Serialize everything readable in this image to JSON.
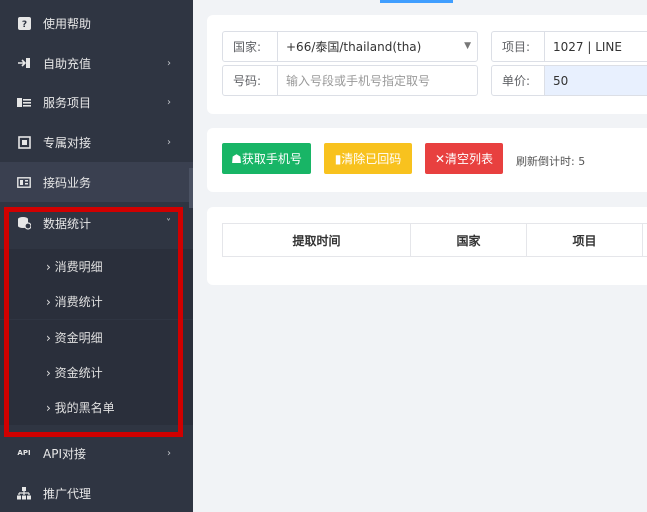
{
  "sidebar": {
    "items": [
      {
        "label": "使用帮助",
        "icon": "help-icon",
        "chevron": ""
      },
      {
        "label": "自助充值",
        "icon": "recharge-icon",
        "chevron": "›"
      },
      {
        "label": "服务项目",
        "icon": "service-icon",
        "chevron": "›"
      },
      {
        "label": "专属对接",
        "icon": "dedicated-icon",
        "chevron": "›"
      },
      {
        "label": "接码业务",
        "icon": "sms-code-icon",
        "chevron": "›"
      },
      {
        "label": "数据统计",
        "icon": "database-icon",
        "chevron": "˅"
      },
      {
        "label": "API对接",
        "icon": "api-icon",
        "chevron": "›"
      },
      {
        "label": "推广代理",
        "icon": "sitemap-icon",
        "chevron": ""
      }
    ],
    "api_icon_text": "API",
    "sub_items": [
      {
        "label": "› 消费明细"
      },
      {
        "label": "› 消费统计"
      },
      {
        "label": "› 资金明细"
      },
      {
        "label": "› 资金统计"
      },
      {
        "label": "› 我的黑名单"
      }
    ]
  },
  "form": {
    "country_label": "国家:",
    "country_value": "+66/泰国/thailand(tha)",
    "project_label": "项目:",
    "project_value": "1027 | LINE",
    "number_label": "号码:",
    "number_placeholder": "输入号段或手机号指定取号",
    "price_label": "单价:",
    "price_value": "50"
  },
  "actions": {
    "get_phone": "☗获取手机号",
    "clear_received": "▮清除已回码",
    "clear_list": "✕清空列表",
    "countdown_label": "刷新倒计时: 5"
  },
  "table": {
    "columns": [
      "提取时间",
      "国家",
      "项目"
    ]
  },
  "colors": {
    "sidebar_bg": "#2f3542",
    "highlight_border": "#d00000",
    "green": "#18b566",
    "yellow": "#f8c21e",
    "red": "#e8403f",
    "accent": "#409eff"
  }
}
